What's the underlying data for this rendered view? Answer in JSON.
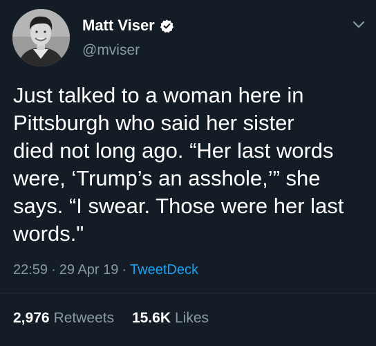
{
  "colors": {
    "background": "#141d26",
    "primary_text": "#ffffff",
    "secondary_text": "#8899a6",
    "link": "#1da1f2",
    "verified": "#ffffff"
  },
  "user": {
    "display_name": "Matt Viser",
    "handle": "@mviser",
    "verified": true,
    "avatar_icon": "profile-photo"
  },
  "tweet": {
    "text": "Just talked to a woman here in\nPittsburgh who said her sister\ndied not long ago. “Her last words\nwere, ‘Trump’s an asshole,’” she\nsays. “I swear. Those were her last\nwords.\"",
    "time": "22:59",
    "date": "29 Apr 19",
    "separator": "·",
    "source": "TweetDeck"
  },
  "stats": {
    "retweets_count": "2,976",
    "retweets_label": "Retweets",
    "likes_count": "15.6K",
    "likes_label": "Likes"
  },
  "icons": {
    "menu": "chevron-down-icon",
    "verified": "verified-badge-icon"
  }
}
